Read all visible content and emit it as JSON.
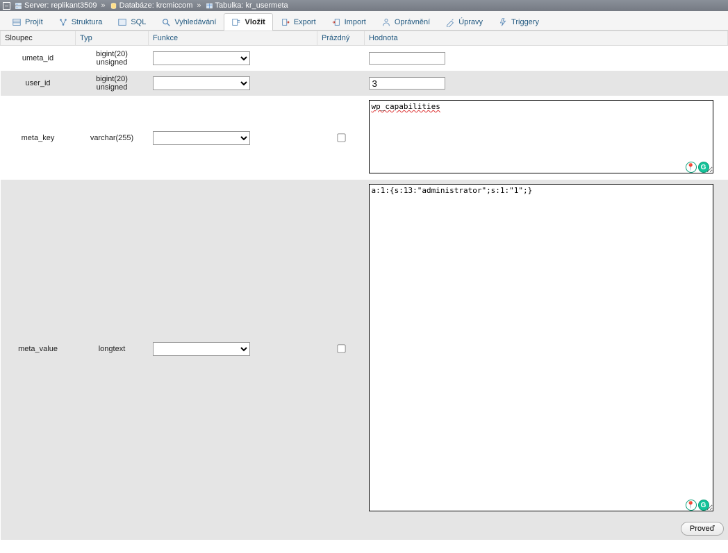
{
  "breadcrumb": {
    "server_prefix": "Server:",
    "server_name": "replikant3509",
    "db_prefix": "Databáze:",
    "db_name": "krcmiccom",
    "table_prefix": "Tabulka:",
    "table_name": "kr_usermeta"
  },
  "tabs": [
    {
      "key": "browse",
      "label": "Projít"
    },
    {
      "key": "structure",
      "label": "Struktura"
    },
    {
      "key": "sql",
      "label": "SQL"
    },
    {
      "key": "search",
      "label": "Vyhledávání"
    },
    {
      "key": "insert",
      "label": "Vložit",
      "active": true
    },
    {
      "key": "export",
      "label": "Export"
    },
    {
      "key": "import",
      "label": "Import"
    },
    {
      "key": "privileges",
      "label": "Oprávnění"
    },
    {
      "key": "operations",
      "label": "Úpravy"
    },
    {
      "key": "triggers",
      "label": "Triggery"
    }
  ],
  "headers": {
    "sloupec": "Sloupec",
    "typ": "Typ",
    "funkce": "Funkce",
    "prazdny": "Prázdný",
    "hodnota": "Hodnota"
  },
  "rows": [
    {
      "name": "umeta_id",
      "type": "bigint(20) unsigned",
      "nullable": false,
      "value": "",
      "control": "input"
    },
    {
      "name": "user_id",
      "type": "bigint(20) unsigned",
      "nullable": false,
      "value": "3",
      "control": "input"
    },
    {
      "name": "meta_key",
      "type": "varchar(255)",
      "nullable": true,
      "value": "wp_capabilities",
      "control": "textarea-small"
    },
    {
      "name": "meta_value",
      "type": "longtext",
      "nullable": true,
      "value": "a:1:{s:13:\"administrator\";s:1:\"1\";}",
      "control": "textarea-big"
    }
  ],
  "submit_label": "Proveď"
}
